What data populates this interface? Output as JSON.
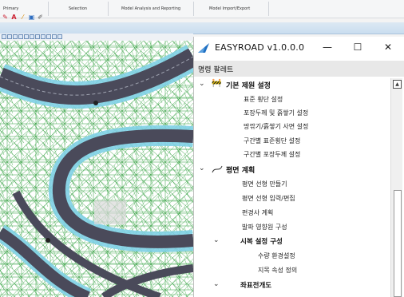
{
  "ribbon": {
    "groups": [
      "Primary",
      "Selection",
      "Model Analysis and Reporting",
      "Model Import/Export"
    ]
  },
  "window": {
    "title": "EASYROAD v1.0.0.0",
    "minimize": "—",
    "maximize": "☐",
    "close": "✕"
  },
  "palette": {
    "header": "명령 팔레트",
    "items": [
      {
        "label": "기본 제원 설정",
        "icon": "road-worker-icon"
      },
      {
        "label": "표준 횡단 설정"
      },
      {
        "label": "포장두께 및 흙쌓기 설정"
      },
      {
        "label": "땅깎기/흙쌓기 사면 설정"
      },
      {
        "label": "구간별 표준횡단 설정"
      },
      {
        "label": "구간별 포장두께 설정"
      },
      {
        "label": "평면 계획",
        "icon": "plan-curve-icon"
      },
      {
        "label": "평면 선형 만들기"
      },
      {
        "label": "평면 선형 입력/편집"
      },
      {
        "label": "편경사 계획"
      },
      {
        "label": "발파 영향원 구성"
      },
      {
        "label": "시복 설정 구성"
      },
      {
        "label": "수량 환경설정"
      },
      {
        "label": "지목 속성 정의"
      },
      {
        "label": "좌표전개도"
      }
    ]
  },
  "colors": {
    "accent": "#1e6fc2",
    "terrain_mesh": "#2e9b3a",
    "road_main": "#4a4a5a",
    "road_edge": "#7fd0e6"
  }
}
